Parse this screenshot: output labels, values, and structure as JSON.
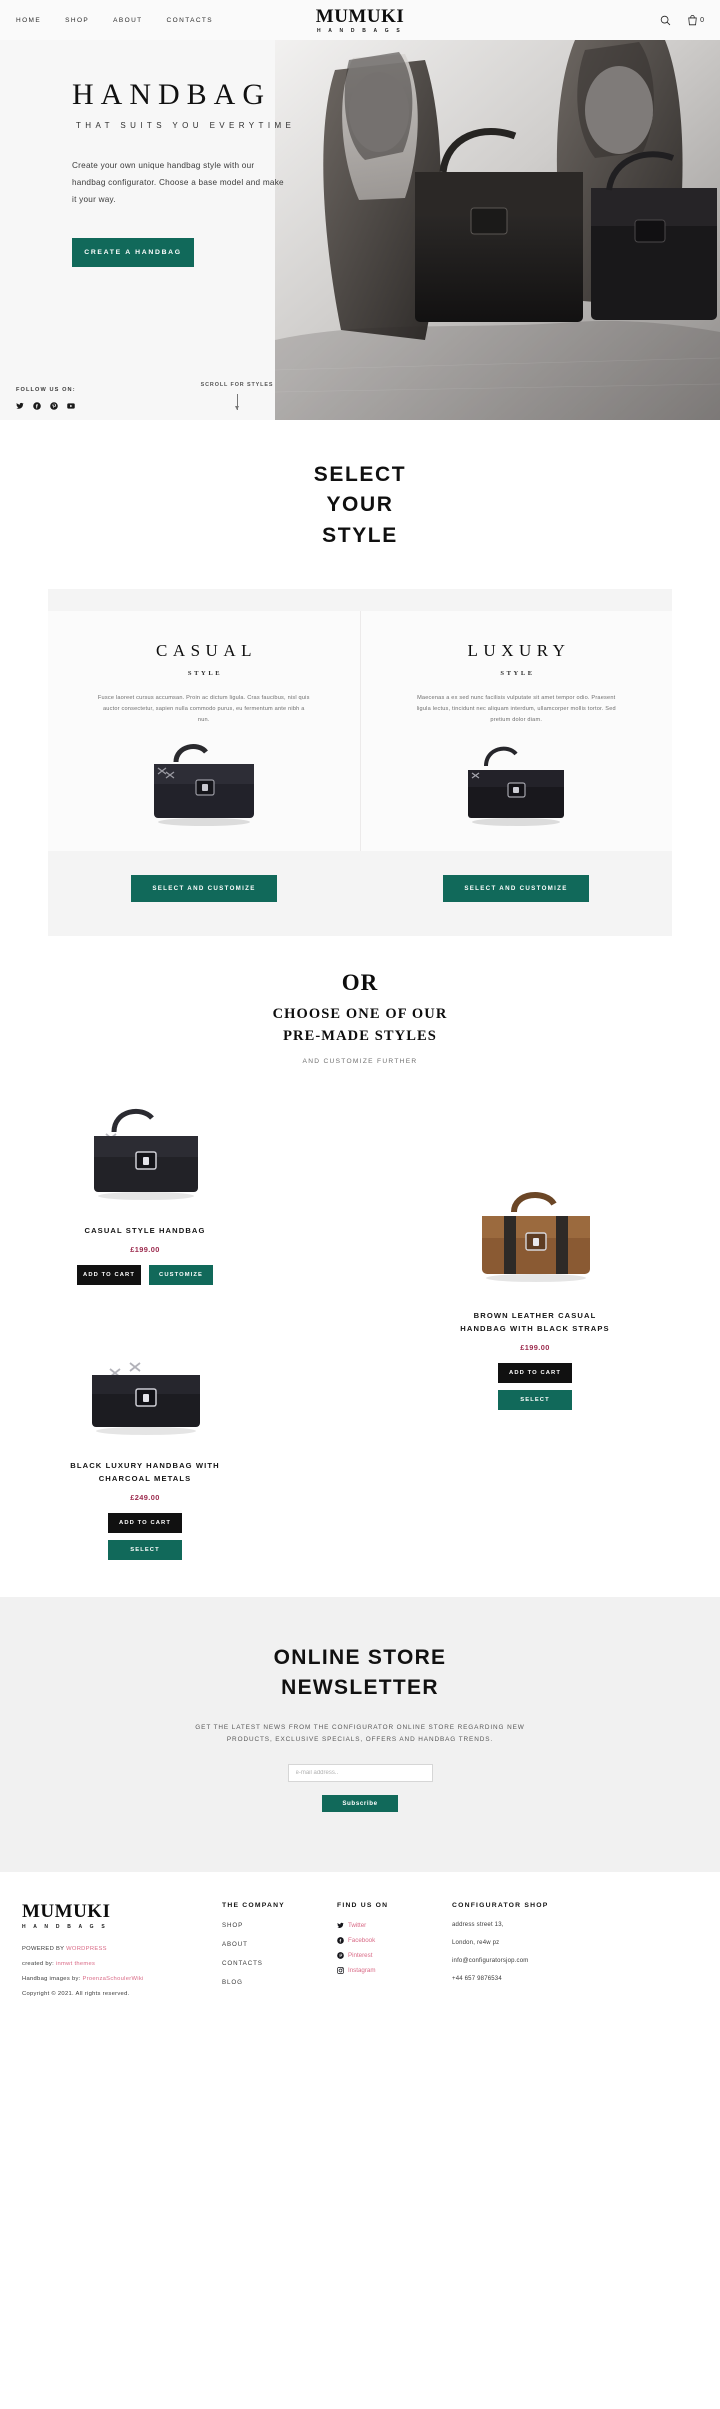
{
  "header": {
    "nav": [
      {
        "label": "HOME"
      },
      {
        "label": "SHOP"
      },
      {
        "label": "ABOUT"
      },
      {
        "label": "CONTACTS"
      }
    ],
    "logo": {
      "main": "MUMUKI",
      "sub": "H A N D B A G S"
    },
    "search_icon": "search-icon",
    "cart_icon": "cart-icon",
    "cart_count": "0"
  },
  "hero": {
    "title": "HANDBAG",
    "subtitle": "THAT SUITS YOU EVERYTIME",
    "paragraph": "Create your own unique handbag style with our handbag configurator. Choose a base model and make it your way.",
    "cta": "CREATE A HANDBAG",
    "follow_label": "FOLLOW US ON:",
    "social": [
      {
        "name": "twitter-icon",
        "label": "Twitter"
      },
      {
        "name": "facebook-icon",
        "label": "Facebook"
      },
      {
        "name": "pinterest-icon",
        "label": "Pinterest"
      },
      {
        "name": "youtube-icon",
        "label": "YouTube"
      }
    ],
    "scroll_label": "SCROLL FOR STYLES"
  },
  "select_style": {
    "heading_line1": "SELECT",
    "heading_line2": "YOUR",
    "heading_line3": "STYLE",
    "cards": [
      {
        "title": "CASUAL",
        "sub": "STYLE",
        "text": "Fusce laoreet cursus accumsan. Proin ac dictum ligula. Cras faucibus, nisl quis auctor consectetur, sapien nulla commodo purus, eu fermentum ante nibh a nun.",
        "cta": "SELECT AND CUSTOMIZE",
        "bag_color": "#1d1d20"
      },
      {
        "title": "LUXURY",
        "sub": "STYLE",
        "text": "Maecenas a ex sed nunc facilisis vulputate sit amet tempor odio. Praesent ligula lectus, tincidunt nec aliquam interdum, ullamcorper mollis tortor. Sed pretium dolor diam.",
        "cta": "SELECT AND CUSTOMIZE",
        "bag_color": "#19181c"
      }
    ]
  },
  "premade": {
    "or": "OR",
    "heading_line1": "CHOOSE ONE OF OUR",
    "heading_line2": "PRE-MADE STYLES",
    "sub": "AND CUSTOMIZE FURTHER"
  },
  "products": [
    {
      "name": "CASUAL STYLE HANDBAG",
      "price": "£199.00",
      "add_label": "ADD TO CART",
      "second_label": "CUSTOMIZE",
      "color": "#222227"
    },
    {
      "name_line1": "BROWN LEATHER CASUAL",
      "name_line2": "HANDBAG WITH BLACK STRAPS",
      "price": "£199.00",
      "add_label": "ADD TO CART",
      "second_label": "SELECT",
      "color": "#8a5a33"
    },
    {
      "name_line1": "BLACK LUXURY HANDBAG WITH",
      "name_line2": "CHARCOAL METALS",
      "price": "£249.00",
      "add_label": "ADD TO CART",
      "second_label": "SELECT",
      "color": "#1c1c20"
    }
  ],
  "newsletter": {
    "title_line1": "ONLINE STORE",
    "title_line2": "NEWSLETTER",
    "text": "GET THE LATEST NEWS FROM THE CONFIGURATOR ONLINE STORE REGARDING NEW PRODUCTS, EXCLUSIVE SPECIALS, OFFERS AND HANDBAG TRENDS.",
    "input_placeholder": "e-mail address..",
    "input_value": "",
    "submit_label": "Subscribe"
  },
  "footer": {
    "logo": {
      "main": "MUMUKI",
      "sub": "H A N D B A G S"
    },
    "powered_prefix": "POWERED BY ",
    "powered_link": "WORDPRESS",
    "created_prefix": "created by: ",
    "created_link": "inmwt themes",
    "images_prefix": "Handbag images by: ",
    "images_link": "ProenzaSchoulerWiki",
    "copyright": "Copyright © 2021. All rights reserved.",
    "company": {
      "heading": "THE COMPANY",
      "links": [
        {
          "label": "SHOP"
        },
        {
          "label": "ABOUT"
        },
        {
          "label": "CONTACTS"
        },
        {
          "label": "BLOG"
        }
      ]
    },
    "find_us": {
      "heading": "FIND US ON",
      "links": [
        {
          "label": "Twitter",
          "icon": "twitter-icon"
        },
        {
          "label": "Facebook",
          "icon": "facebook-icon"
        },
        {
          "label": "Pinterest",
          "icon": "pinterest-icon"
        },
        {
          "label": "Instagram",
          "icon": "instagram-icon"
        }
      ]
    },
    "shop": {
      "heading": "CONFIGURATOR SHOP",
      "lines": [
        {
          "text": "address street 13,"
        },
        {
          "text": "London, re4w pz"
        },
        {
          "text": "info@configuratorsjop.com"
        },
        {
          "text": "+44 657 9876534"
        }
      ]
    }
  },
  "colors": {
    "accent_green": "#11695a",
    "price": "#9c2b4e",
    "link_pink": "#d96a86",
    "dark": "#111111"
  }
}
